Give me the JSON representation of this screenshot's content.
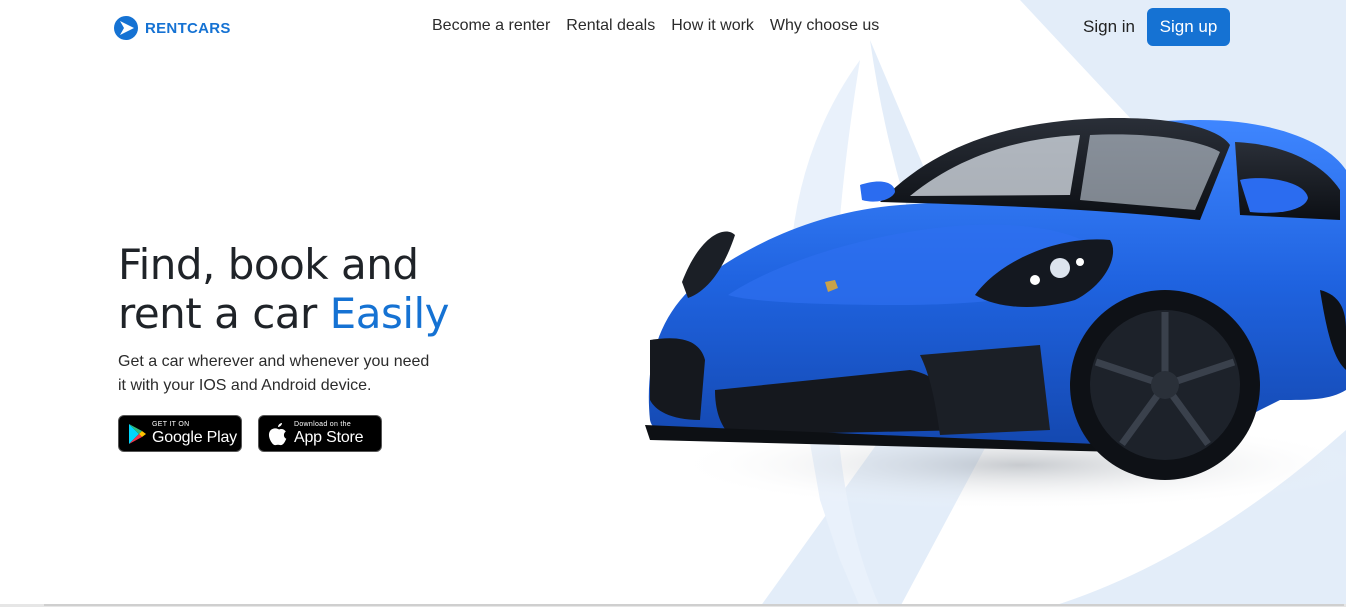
{
  "brand": {
    "name": "RENTCARS",
    "color": "#1572d3"
  },
  "nav": {
    "items": [
      {
        "label": "Become a renter"
      },
      {
        "label": "Rental deals"
      },
      {
        "label": "How it work"
      },
      {
        "label": "Why choose us"
      }
    ]
  },
  "auth": {
    "signin": "Sign in",
    "signup": "Sign up"
  },
  "hero": {
    "title_line1": "Find, book and",
    "title_line2_prefix": "rent a car ",
    "title_accent": "Easily",
    "subtitle_line1": "Get a car wherever and whenever you need",
    "subtitle_line2": "it with your IOS and Android device."
  },
  "stores": {
    "google": {
      "small": "GET IT ON",
      "big": "Google Play",
      "icon": "google-play-icon"
    },
    "apple": {
      "small": "Download on the",
      "big": "App Store",
      "icon": "apple-icon"
    }
  },
  "colors": {
    "accent": "#1572d3",
    "car_body": "#1f63e0",
    "background_shape": "#e3edf9"
  }
}
